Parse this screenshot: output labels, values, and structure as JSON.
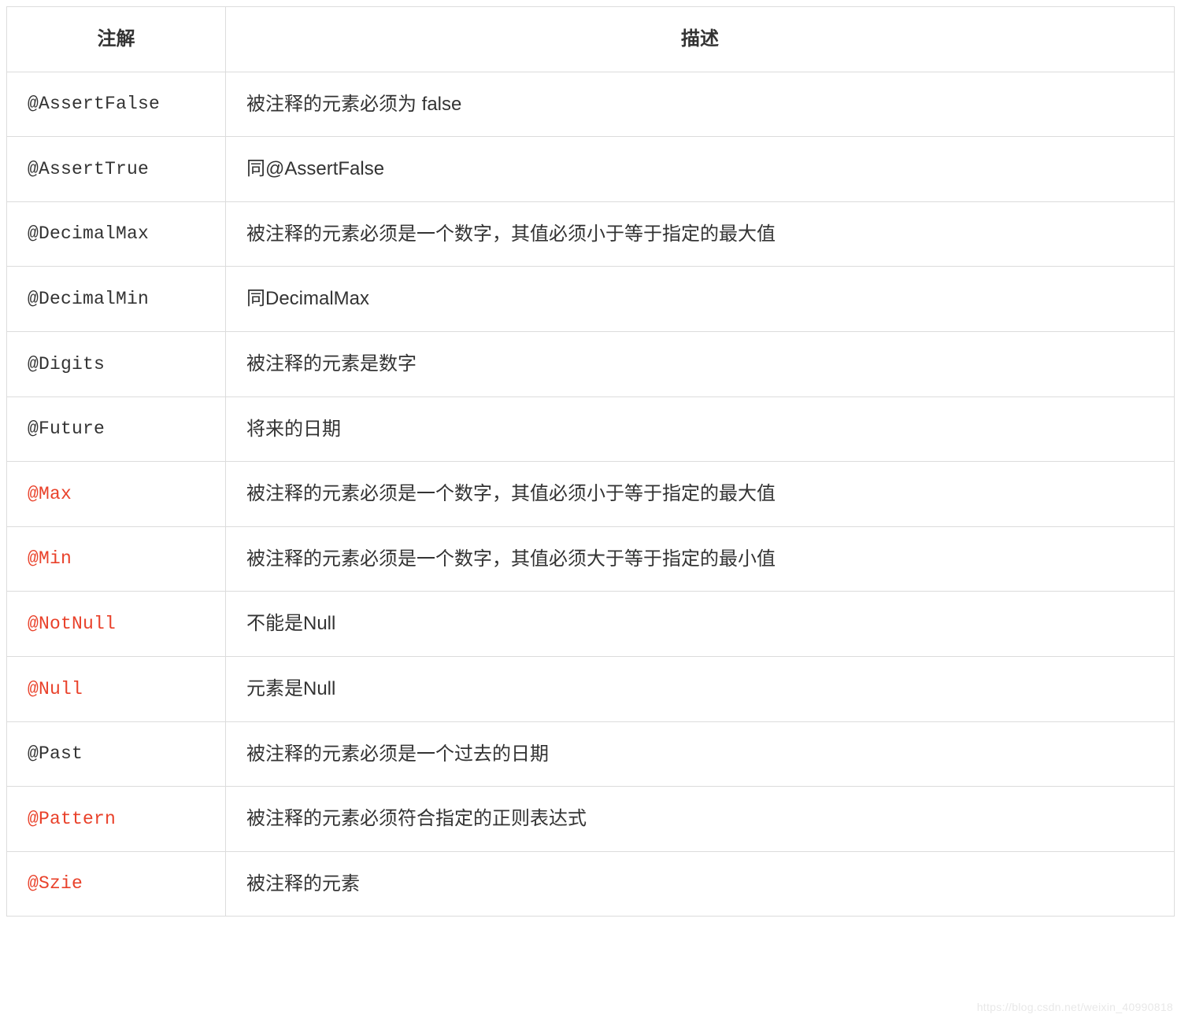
{
  "table": {
    "headers": {
      "annotation": "注解",
      "description": "描述"
    },
    "rows": [
      {
        "annotation": "@AssertFalse",
        "description": "被注释的元素必须为 false",
        "highlight": false
      },
      {
        "annotation": "@AssertTrue",
        "description": "同@AssertFalse",
        "highlight": false
      },
      {
        "annotation": "@DecimalMax",
        "description": "被注释的元素必须是一个数字，其值必须小于等于指定的最大值",
        "highlight": false
      },
      {
        "annotation": "@DecimalMin",
        "description": "同DecimalMax",
        "highlight": false
      },
      {
        "annotation": "@Digits",
        "description": "被注释的元素是数字",
        "highlight": false
      },
      {
        "annotation": "@Future",
        "description": "将来的日期",
        "highlight": false
      },
      {
        "annotation": "@Max",
        "description": "被注释的元素必须是一个数字，其值必须小于等于指定的最大值",
        "highlight": true
      },
      {
        "annotation": "@Min",
        "description": "被注释的元素必须是一个数字，其值必须大于等于指定的最小值",
        "highlight": true
      },
      {
        "annotation": "@NotNull",
        "description": "不能是Null",
        "highlight": true
      },
      {
        "annotation": "@Null",
        "description": "元素是Null",
        "highlight": true
      },
      {
        "annotation": "@Past",
        "description": "被注释的元素必须是一个过去的日期",
        "highlight": false
      },
      {
        "annotation": "@Pattern",
        "description": "被注释的元素必须符合指定的正则表达式",
        "highlight": true
      },
      {
        "annotation": "@Szie",
        "description": "被注释的元素",
        "highlight": true
      }
    ]
  },
  "colors": {
    "highlight": "#e9412a",
    "text": "#333333",
    "border": "#dcdcdc"
  },
  "watermark": "https://blog.csdn.net/weixin_40990818"
}
